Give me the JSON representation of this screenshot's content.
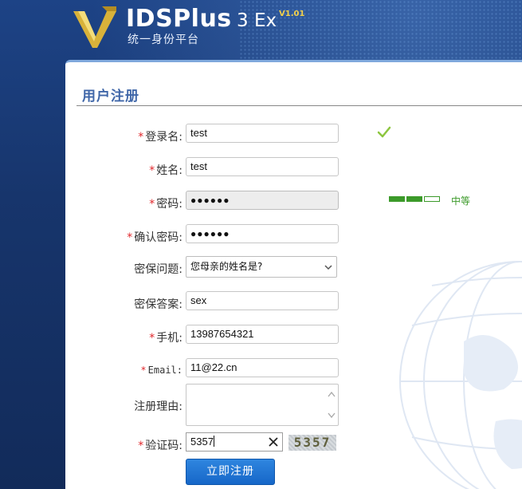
{
  "header": {
    "brand": "IDSPlus",
    "edition": "3 Ex",
    "version": "V1.01",
    "subtitle": "统一身份平台"
  },
  "panel": {
    "title": "用户注册"
  },
  "form": {
    "username": {
      "label": "登录名:",
      "value": "test",
      "required": true
    },
    "name": {
      "label": "姓名:",
      "value": "test",
      "required": true
    },
    "password": {
      "label": "密码:",
      "value": "●●●●●●",
      "required": true,
      "strength_text": "中等",
      "strength_level": 2,
      "strength_max": 3
    },
    "confirm_password": {
      "label": "确认密码:",
      "value": "●●●●●●",
      "required": true
    },
    "security_question": {
      "label": "密保问题:",
      "value": "您母亲的姓名是?",
      "required": false
    },
    "security_answer": {
      "label": "密保答案:",
      "value": "sex",
      "required": false
    },
    "phone": {
      "label": "手机:",
      "value": "13987654321",
      "required": true
    },
    "email": {
      "label": "Email:",
      "value": "11@22.cn",
      "required": true
    },
    "reason": {
      "label": "注册理由:",
      "value": "",
      "required": false
    },
    "captcha": {
      "label": "验证码:",
      "value": "5357",
      "image_text": "5357",
      "required": true
    },
    "required_mark": "*",
    "submit_label": "立即注册"
  },
  "colors": {
    "accent": "#3f66a8",
    "required": "#e0262a",
    "valid": "#3c9a2a",
    "button": "#1f74d2"
  }
}
